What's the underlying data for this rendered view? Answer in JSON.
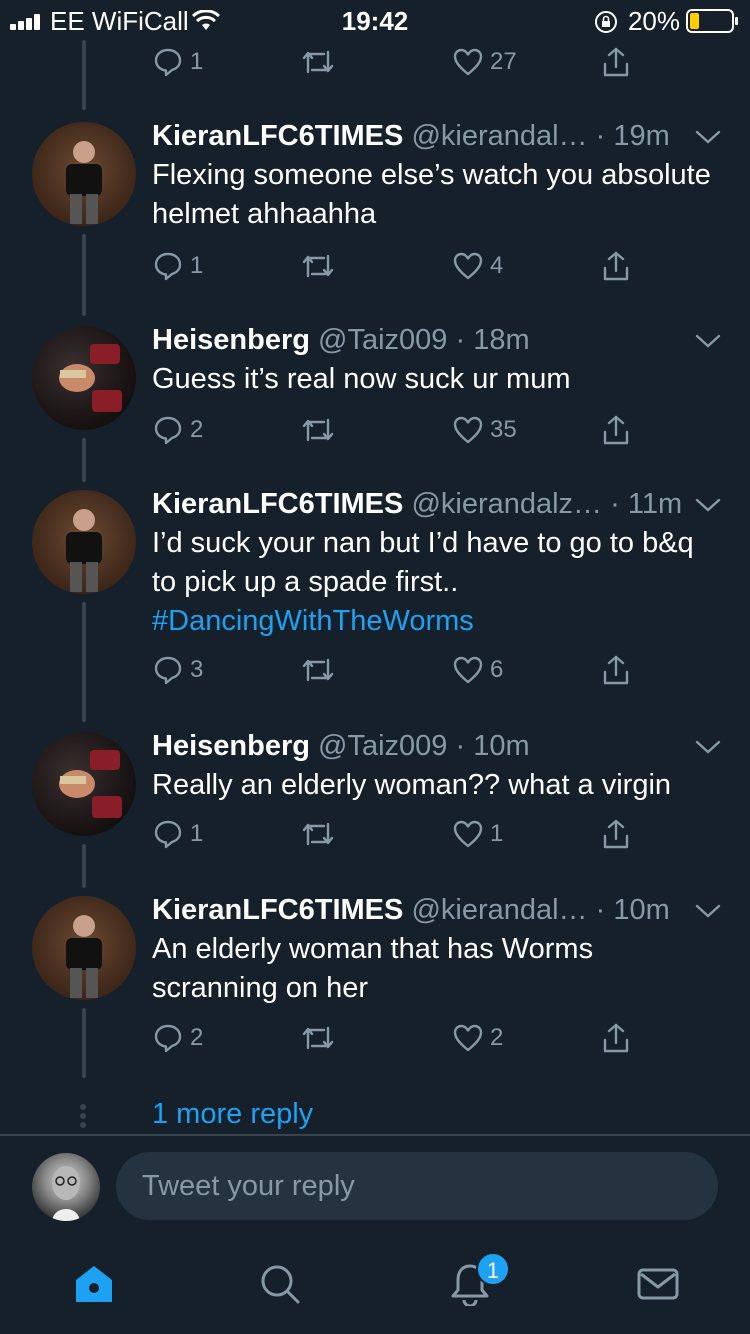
{
  "status_bar": {
    "carrier": "EE WiFiCall",
    "time": "19:42",
    "battery": "20%"
  },
  "top_actions": {
    "reply_count": "1",
    "like_count": "27"
  },
  "tweets": [
    {
      "name": "KieranLFC6TIMES",
      "handle": "@kierandal…",
      "time": "· 19m",
      "text": "Flexing someone else’s watch you absolute helmet ahhaahha",
      "replies": "1",
      "likes": "4",
      "avatar": "kieran"
    },
    {
      "name": "Heisenberg",
      "handle": "@Taiz009",
      "time": "· 18m",
      "text": "Guess it’s real now suck ur mum",
      "replies": "2",
      "likes": "35",
      "avatar": "heisenberg"
    },
    {
      "name": "KieranLFC6TIMES",
      "handle": "@kierandalz…",
      "time": "· 11m",
      "text": "I’d suck your nan but I’d have to go to b&q to pick up a spade first..",
      "hashtag": "#DancingWithTheWorms",
      "replies": "3",
      "likes": "6",
      "avatar": "kieran"
    },
    {
      "name": "Heisenberg",
      "handle": "@Taiz009",
      "time": "· 10m",
      "text": "Really an elderly woman?? what a virgin",
      "replies": "1",
      "likes": "1",
      "avatar": "heisenberg"
    },
    {
      "name": "KieranLFC6TIMES",
      "handle": "@kierandal…",
      "time": "· 10m",
      "text": "An elderly woman that has Worms scranning on her",
      "replies": "2",
      "likes": "2",
      "avatar": "kieran"
    }
  ],
  "more_reply": "1 more reply",
  "reply_box": {
    "placeholder": "Tweet your reply"
  },
  "tab_bar": {
    "items": [
      "home-icon",
      "search-icon",
      "notifications-icon",
      "messages-icon"
    ],
    "notification_badge": "1"
  },
  "colors": {
    "background": "#15202b",
    "accent": "#1da1f2",
    "secondary_text": "#8899a6",
    "divider": "#38444d"
  }
}
